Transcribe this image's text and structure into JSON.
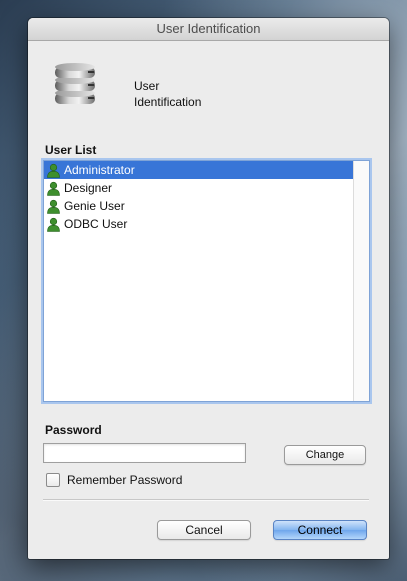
{
  "window": {
    "title": "User Identification"
  },
  "header": {
    "text": "User\nIdentification",
    "icon": "database-icon"
  },
  "user_list": {
    "label": "User List",
    "items": [
      {
        "label": "Administrator",
        "selected": true,
        "icon": "user-icon"
      },
      {
        "label": "Designer",
        "selected": false,
        "icon": "user-icon"
      },
      {
        "label": "Genie User",
        "selected": false,
        "icon": "user-icon"
      },
      {
        "label": "ODBC User",
        "selected": false,
        "icon": "user-icon"
      }
    ]
  },
  "password": {
    "label": "Password",
    "value": "",
    "change_label": "Change"
  },
  "remember": {
    "label": "Remember Password",
    "checked": false
  },
  "buttons": {
    "cancel": "Cancel",
    "connect": "Connect"
  },
  "colors": {
    "selection": "#3875d7",
    "default_button": "#6fa6ec",
    "window_bg": "#ececec"
  }
}
